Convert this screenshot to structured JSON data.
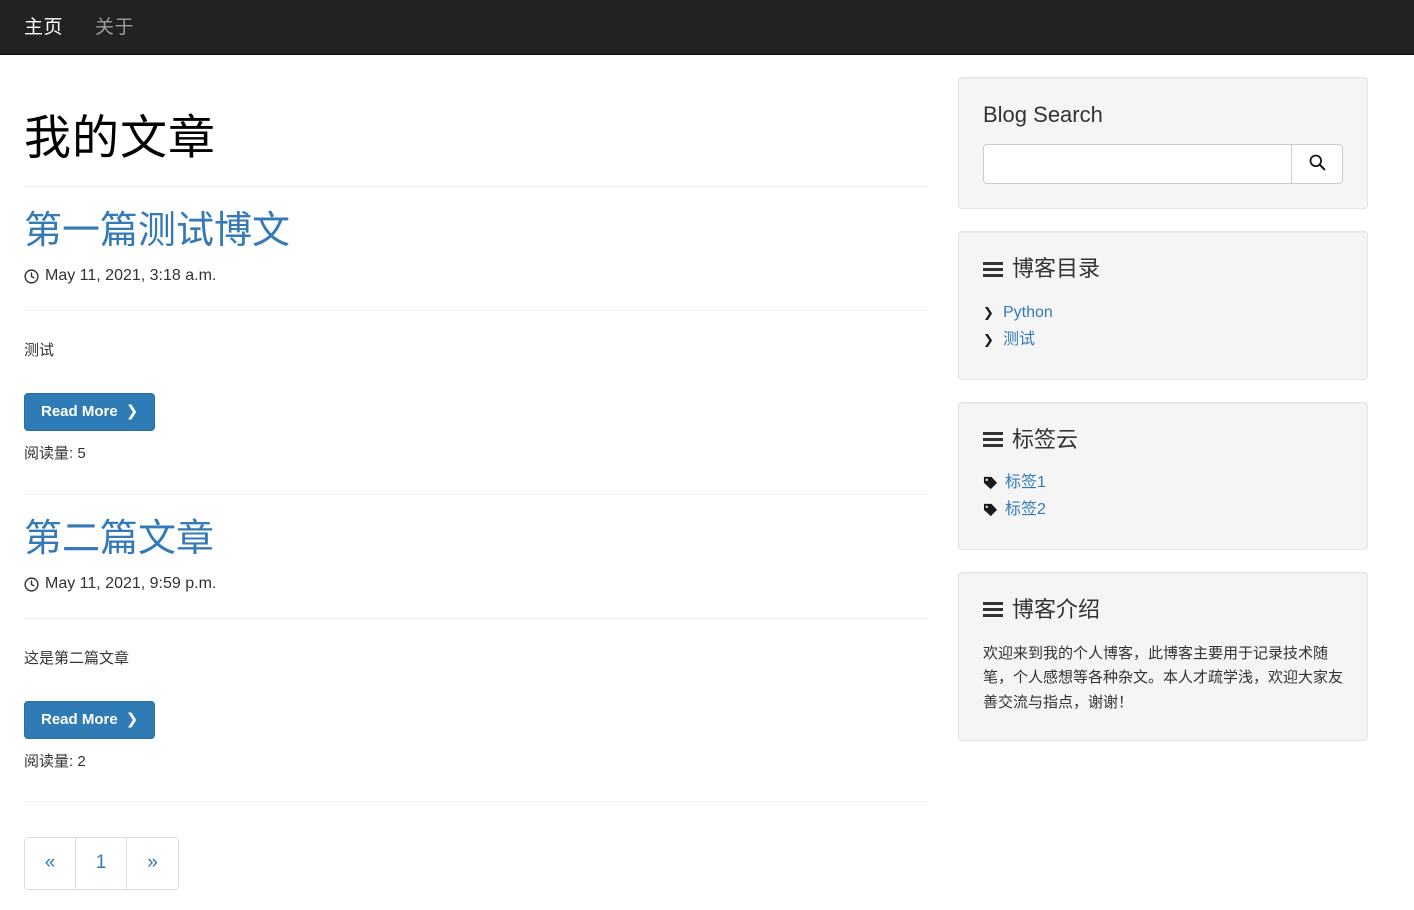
{
  "navbar": {
    "items": [
      {
        "label": "主页",
        "active": true
      },
      {
        "label": "关于",
        "active": false
      }
    ]
  },
  "main": {
    "page_title": "我的文章",
    "posts": [
      {
        "title": "第一篇测试博文",
        "date": "May 11, 2021, 3:18 a.m.",
        "excerpt": "测试",
        "read_more_label": "Read More",
        "read_count_label": "阅读量: 5"
      },
      {
        "title": "第二篇文章",
        "date": "May 11, 2021, 9:59 p.m.",
        "excerpt": "这是第二篇文章",
        "read_more_label": "Read More",
        "read_count_label": "阅读量: 2"
      }
    ],
    "pagination": {
      "prev": "«",
      "pages": [
        "1"
      ],
      "next": "»"
    }
  },
  "sidebar": {
    "search": {
      "title": "Blog Search",
      "value": "",
      "placeholder": "",
      "button_icon": "search-icon"
    },
    "categories": {
      "title": "博客目录",
      "icon": "list-icon",
      "items": [
        {
          "label": "Python",
          "icon": "chevron-right-icon"
        },
        {
          "label": "测试",
          "icon": "chevron-right-icon"
        }
      ]
    },
    "tags": {
      "title": "标签云",
      "icon": "list-icon",
      "items": [
        {
          "label": "标签1",
          "icon": "tag-icon"
        },
        {
          "label": "标签2",
          "icon": "tag-icon"
        }
      ]
    },
    "about": {
      "title": "博客介绍",
      "icon": "list-icon",
      "text": "欢迎来到我的个人博客，此博客主要用于记录技术随笔，个人感想等各种杂文。本人才疏学浅，欢迎大家友善交流与指点，谢谢！"
    }
  },
  "colors": {
    "navbar_bg": "#222222",
    "link_blue": "#337ab7",
    "button_blue": "#2e7bb5",
    "panel_bg": "#f5f5f5",
    "panel_border": "#e3e3e3"
  }
}
